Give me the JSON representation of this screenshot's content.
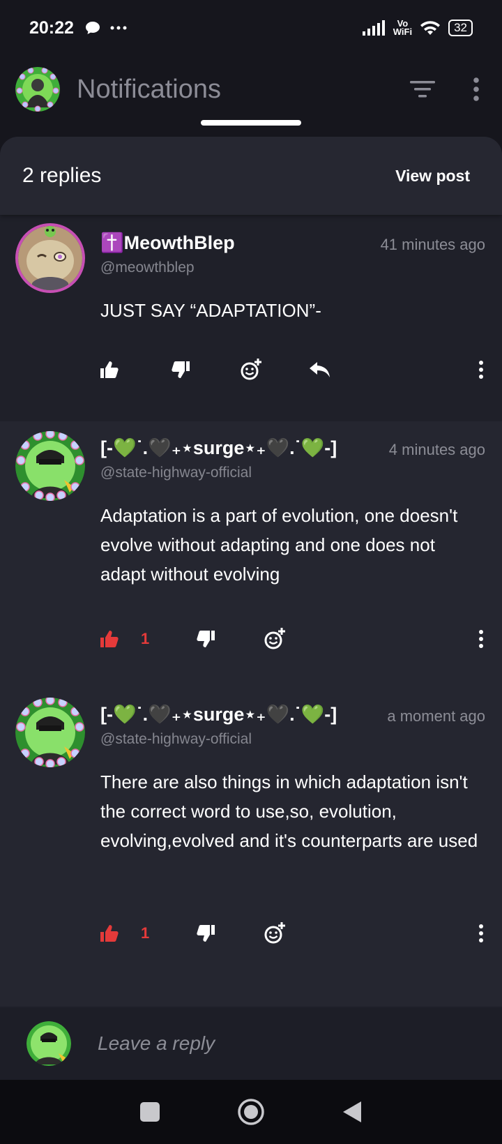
{
  "status_bar": {
    "time": "20:22",
    "vowifi_top": "Vo",
    "vowifi_bottom": "WiFi",
    "battery": "32",
    "icons": [
      "chat-bubble-icon",
      "more-dots-icon",
      "signal-icon",
      "wifi-icon",
      "battery-icon"
    ]
  },
  "app_bar": {
    "title": "Notifications",
    "icons": [
      "filter-icon",
      "overflow-menu-icon"
    ]
  },
  "sheet": {
    "reply_count": "2 replies",
    "view_post": "View post"
  },
  "comments": [
    {
      "name_prefix": "✝️",
      "name": "MeowthBlep",
      "handle": "@meowthblep",
      "time": "41 minutes ago",
      "body": "JUST SAY “ADAPTATION”-",
      "likes": ""
    },
    {
      "name": "[-💚˙.🖤₊⋆surge⋆₊🖤.˙💚-]",
      "handle": "@state-highway-official",
      "time": "4 minutes ago",
      "body": "Adaptation is a part of evolution, one doesn't evolve without adapting and one does not adapt without evolving",
      "likes": "1"
    },
    {
      "name": "[-💚˙.🖤₊⋆surge⋆₊🖤.˙💚-]",
      "handle": "@state-highway-official",
      "time": "a moment ago",
      "body": "There are also things in which adaptation isn't the correct word to use,so, evolution, evolving,evolved and it's counterparts are used",
      "likes": "1"
    }
  ],
  "reply_bar": {
    "placeholder": "Leave a reply"
  },
  "colors": {
    "background": "#16161d",
    "sheet": "#22232d",
    "liked": "#e53a3a",
    "muted_text": "#8c8d96",
    "avatar_ring": "#c74fb4"
  }
}
